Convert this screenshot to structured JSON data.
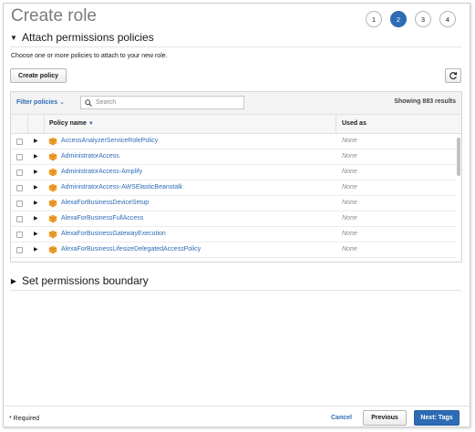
{
  "page": {
    "title": "Create role"
  },
  "steps": [
    "1",
    "2",
    "3",
    "4"
  ],
  "active_step": "2",
  "attach_section": {
    "title": "Attach permissions policies",
    "description": "Choose one or more policies to attach to your new role."
  },
  "toolbar": {
    "create_policy_label": "Create policy"
  },
  "filter": {
    "label": "Filter policies",
    "search_placeholder": "Search",
    "results_text": "Showing 883 results"
  },
  "table": {
    "columns": [
      "Policy name",
      "Used as"
    ],
    "rows": [
      {
        "name": "AccessAnalyzerServiceRolePolicy",
        "used_as": "None"
      },
      {
        "name": "AdministratorAccess",
        "used_as": "None"
      },
      {
        "name": "AdministratorAccess-Amplify",
        "used_as": "None"
      },
      {
        "name": "AdministratorAccess-AWSElasticBeanstalk",
        "used_as": "None"
      },
      {
        "name": "AlexaForBusinessDeviceSetup",
        "used_as": "None"
      },
      {
        "name": "AlexaForBusinessFullAccess",
        "used_as": "None"
      },
      {
        "name": "AlexaForBusinessGatewayExecution",
        "used_as": "None"
      },
      {
        "name": "AlexaForBusinessLifesizeDelegatedAccessPolicy",
        "used_as": "None"
      }
    ]
  },
  "boundary_section": {
    "title": "Set permissions boundary"
  },
  "footer": {
    "required_text": "* Required",
    "cancel_label": "Cancel",
    "previous_label": "Previous",
    "next_label": "Next: Tags"
  },
  "colors": {
    "accent": "#2e6bb5",
    "policy_icon": "#f0a030"
  },
  "icons": {
    "refresh": "refresh-icon",
    "search": "search-icon",
    "policy": "policy-box-icon",
    "sort": "sort-down-icon"
  }
}
